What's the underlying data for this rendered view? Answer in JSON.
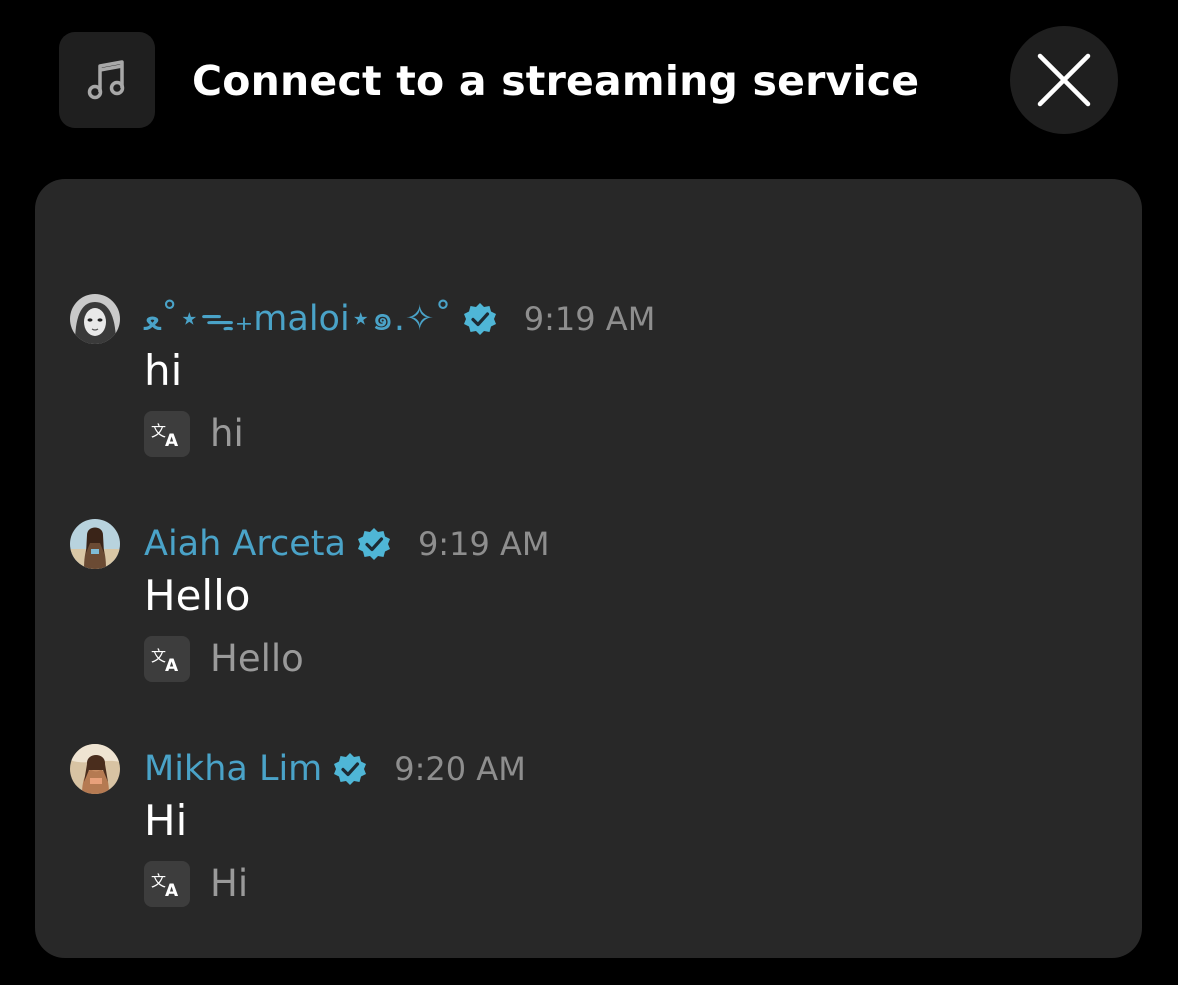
{
  "header": {
    "title": "Connect to a streaming service",
    "music_icon": "music-note-icon",
    "close_icon": "close-icon"
  },
  "colors": {
    "background": "#000000",
    "card": "#282828",
    "author_name": "#4aa3c8",
    "verified_badge": "#4fb6d6",
    "timestamp": "#8e8e8e",
    "translated_text": "#9a9a9a"
  },
  "messages": [
    {
      "author": "ﻌ˚⋆ᯓ₊maloi⋆๑.✧˚",
      "time": "9:19 AM",
      "text": "hi",
      "translation": "hi"
    },
    {
      "author": "Aiah Arceta",
      "time": "9:19 AM",
      "text": "Hello",
      "translation": "Hello"
    },
    {
      "author": "Mikha Lim",
      "time": "9:20 AM",
      "text": "Hi",
      "translation": "Hi"
    }
  ]
}
